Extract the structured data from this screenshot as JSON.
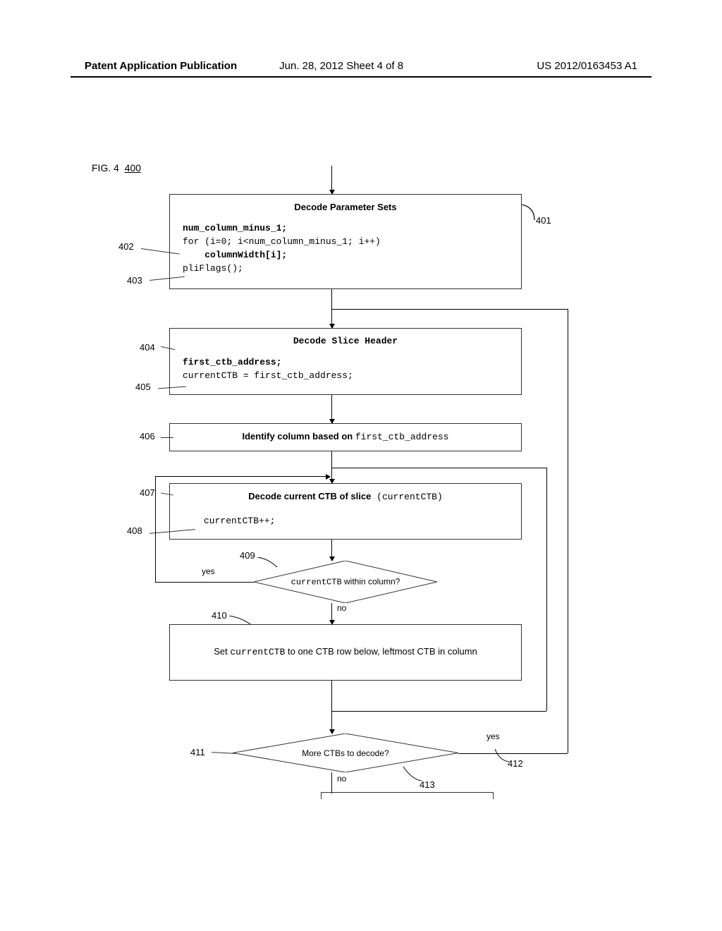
{
  "header": {
    "left": "Patent Application Publication",
    "center": "Jun. 28, 2012  Sheet 4 of 8",
    "right": "US 2012/0163453 A1"
  },
  "figure": {
    "prefix": "FIG. 4",
    "ref": "400"
  },
  "box401": {
    "title": "Decode Parameter Sets",
    "line1": "num_column_minus_1;",
    "line2": "for (i=0; i<num_column_minus_1; i++)",
    "line3": "columnWidth[i];",
    "line4": "pliFlags();"
  },
  "box404": {
    "title": "Decode Slice Header",
    "line1": "first_ctb_address;",
    "line2": "currentCTB = first_ctb_address;"
  },
  "box406": {
    "text_bold": "Identify column based on ",
    "text_code": "first_ctb_address"
  },
  "box407": {
    "text_bold": "Decode current CTB of slice",
    "text_code": " (currentCTB)",
    "line2": "currentCTB++;"
  },
  "d409": {
    "text_code": "currentCTB",
    "text_plain": " within column?",
    "yes": "yes",
    "no": "no"
  },
  "box410": {
    "prefix": "Set ",
    "code": "currentCTB",
    "suffix": " to one CTB row below, leftmost CTB in column"
  },
  "d411": {
    "text": "More CTBs to decode?",
    "yes": "yes",
    "no": "no"
  },
  "labels": {
    "l401": "401",
    "l402": "402",
    "l403": "403",
    "l404": "404",
    "l405": "405",
    "l406": "406",
    "l407": "407",
    "l408": "408",
    "l409": "409",
    "l410": "410",
    "l411": "411",
    "l412": "412",
    "l413": "413"
  }
}
